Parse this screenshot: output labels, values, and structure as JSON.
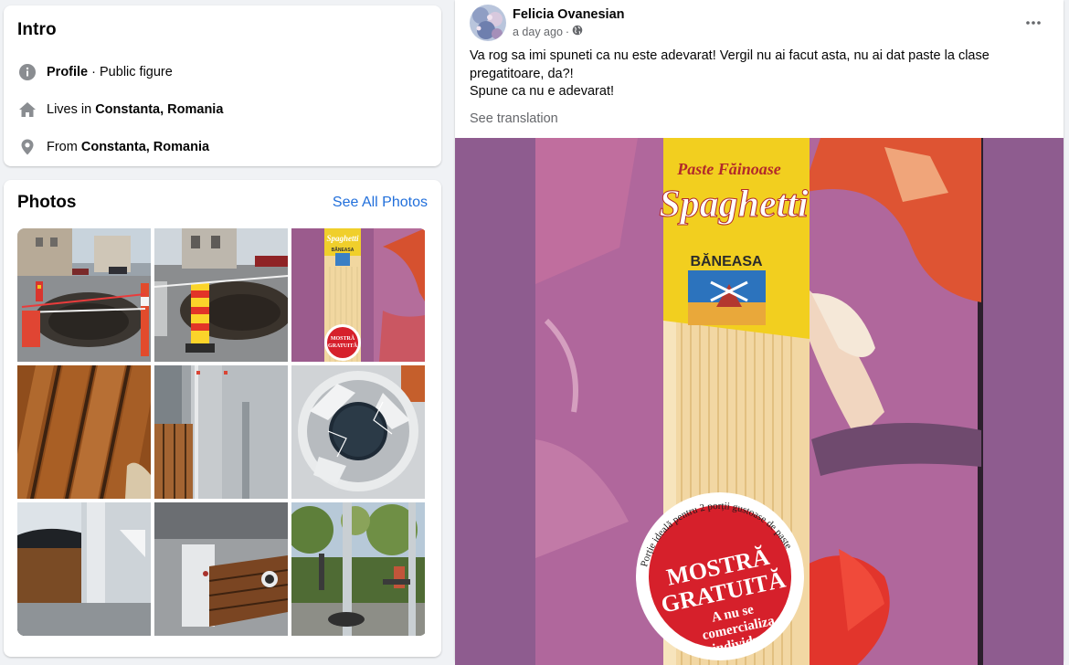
{
  "intro": {
    "title": "Intro",
    "profile_label": "Profile",
    "profile_sep": " · ",
    "profile_type": "Public figure",
    "lives_prefix": "Lives in ",
    "lives_place": "Constanta, Romania",
    "from_prefix": "From ",
    "from_place": "Constanta, Romania"
  },
  "photos": {
    "title": "Photos",
    "see_all": "See All Photos"
  },
  "post": {
    "author": "Felicia Ovanesian",
    "time": "a day ago",
    "time_sep": " · ",
    "audience_icon": "globe-icon",
    "text_line1": "Va rog sa imi spuneti ca nu este adevarat! Vergil nu ai facut asta, nu ai dat paste la clase",
    "text_line2": "pregatitoare, da?!",
    "text_line3": "Spune ca nu e adevarat!",
    "see_translation": "See translation",
    "more_icon": "more-options-icon"
  },
  "package": {
    "brand_top": "Paste Făinoase",
    "product": "Spaghetti",
    "maker": "BĂNEASA",
    "sticker_arc": "Porție ideală pentru 2 porții gustoase de paste",
    "sticker_title1": "MOSTRĂ",
    "sticker_title2": "GRATUITĂ",
    "sticker_sub1": "A nu se",
    "sticker_sub2": "comercializa",
    "sticker_sub3": "individual."
  },
  "thumb_package": {
    "product": "Spaghetti",
    "maker": "BĂNEASA",
    "sticker1": "MOSTRĂ",
    "sticker2": "GRATUITĂ"
  },
  "colors": {
    "link": "#216fdb",
    "secondary_text": "#65676b",
    "photo_bg": "#8e5c8f"
  }
}
